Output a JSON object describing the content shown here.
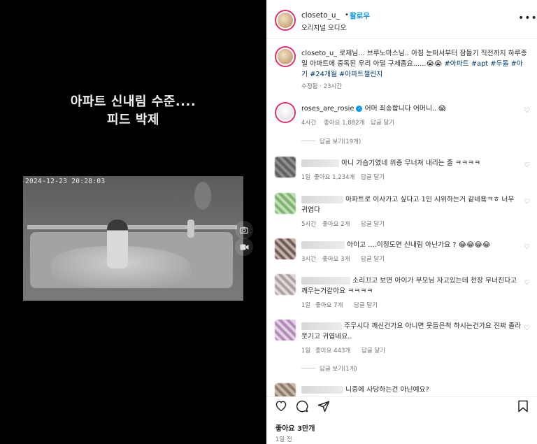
{
  "video": {
    "overlay_line1": "아파트 신내림 수준....",
    "overlay_line2": "피드 박제",
    "timestamp": "2024-12-23 20:28:03",
    "ctrl_camera_icon": "camera-icon",
    "ctrl_video_icon": "video-icon"
  },
  "header": {
    "username": "closeto_u_",
    "dot": "•",
    "follow_label": "팔로우",
    "audio_label": "오리지널 오디오",
    "more_icon": "more-horizontal-icon"
  },
  "caption": {
    "username": "closeto_u_",
    "text": "로제님... 브루노마스님.. 아침 눈떠서부터 잠들기 직전까지 하루종일 아파트에 중독된 우리 아덜 구제좀요......😭😭",
    "hashtags": "#아파트 #apt #두돌 #아기 #24개월 #아파트챌린지",
    "edited": "수정됨 · 23시간"
  },
  "comments": [
    {
      "username": "roses_are_rosie",
      "verified": true,
      "text": "어머 죄송합니다 어머니.. 😱",
      "time": "4시간",
      "likes": "좋아요 1,882개",
      "reply": "답글 달기",
      "view_replies": "답글 보기(19개)"
    },
    {
      "username": "",
      "text": "아니 가습기였네 위층 무너져 내리는 줄 ㅋㅋㅋㅋ",
      "time": "1일",
      "likes": "좋아요 1,234개",
      "reply": "답글 달기"
    },
    {
      "username": "",
      "text": "아파트로 이사가고 싶다고 1인 시위하는거 같네욬ㅋㅎ 너무 귀엽다",
      "time": "5시간",
      "likes": "좋아요 2개",
      "reply": "답글 달기"
    },
    {
      "username": "",
      "text": "아이고 ....이정도면 신내림 아닌가요 ? 😂😂😂😂",
      "time": "3시간",
      "likes": "좋아요 3개",
      "reply": "답글 달기"
    },
    {
      "username": "",
      "text": "소리끄고 보면 아이가 부모님 자고있는데 천장 무너진다고 깨우는거같아요 ㅋㅋㅋㅋ",
      "time": "1일",
      "likes": "좋아요 7개",
      "reply": "답글 달기"
    },
    {
      "username": "",
      "text": "주무시다 깨신건가요 아니면 웃들은척 하시는건가요 진짜 졸라웃기고 귀엽네요..",
      "time": "1일",
      "likes": "좋아요 443개",
      "reply": "답글 달기",
      "view_replies": "답글 보기(1개)"
    },
    {
      "username": "",
      "text": "니중에 사당하는건 아닌예요?"
    }
  ],
  "actions": {
    "like_icon": "heart-icon",
    "comment_icon": "comment-icon",
    "share_icon": "send-icon",
    "save_icon": "bookmark-icon",
    "likes": "좋아요 3만개",
    "time": "1일 전"
  }
}
